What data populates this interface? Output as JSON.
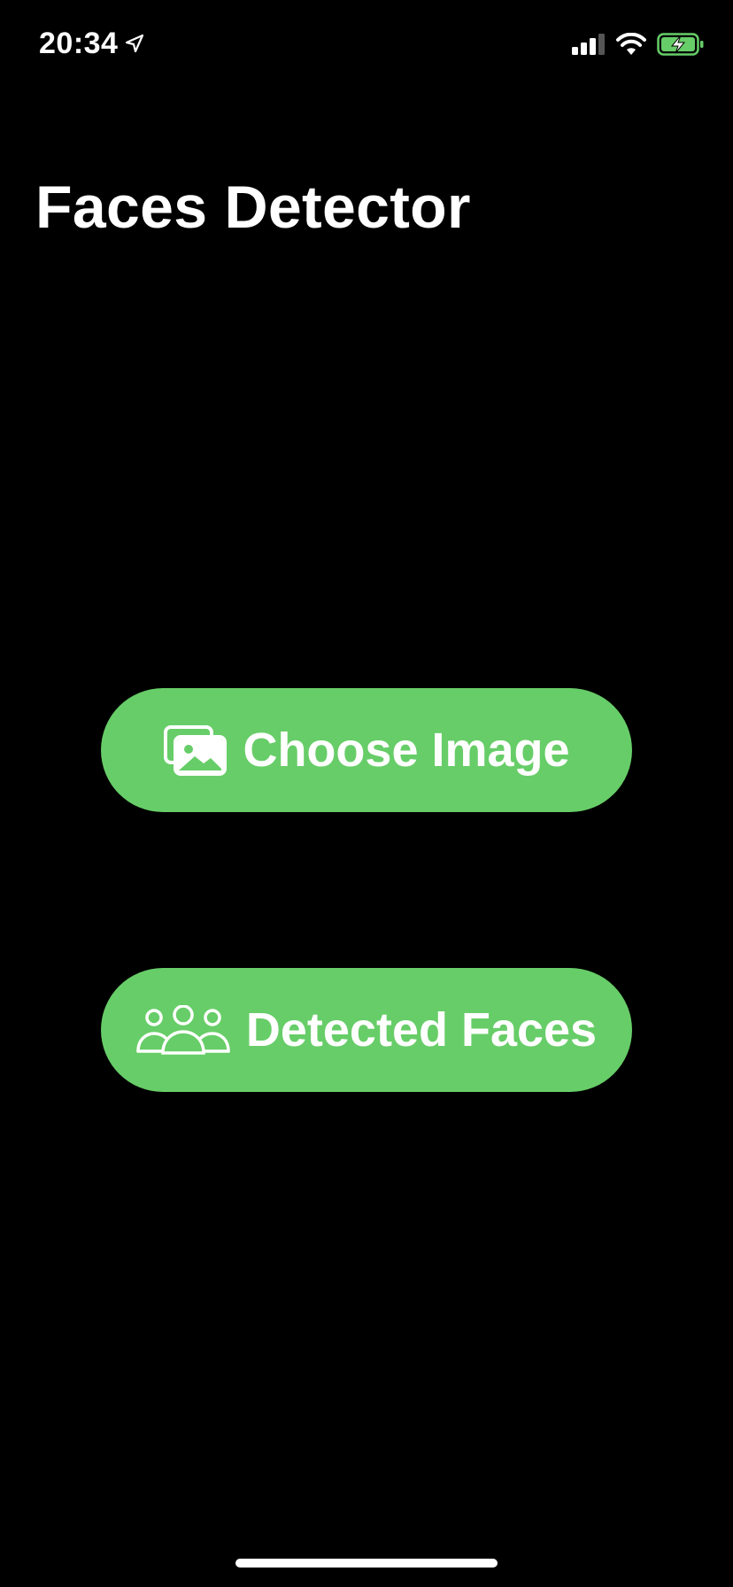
{
  "status_bar": {
    "time": "20:34",
    "icons": [
      "location-arrow-icon",
      "cellular-signal-icon",
      "wifi-icon",
      "battery-charging-icon"
    ],
    "battery_color": "#67CD68"
  },
  "header": {
    "title": "Faces Detector"
  },
  "main": {
    "choose_image": {
      "label": "Choose Image",
      "icon": "photo-stack-icon"
    },
    "detected_faces": {
      "label": "Detected Faces",
      "icon": "three-people-icon"
    }
  },
  "colors": {
    "background": "#000000",
    "accent": "#67CD68",
    "text": "#FFFFFF"
  }
}
